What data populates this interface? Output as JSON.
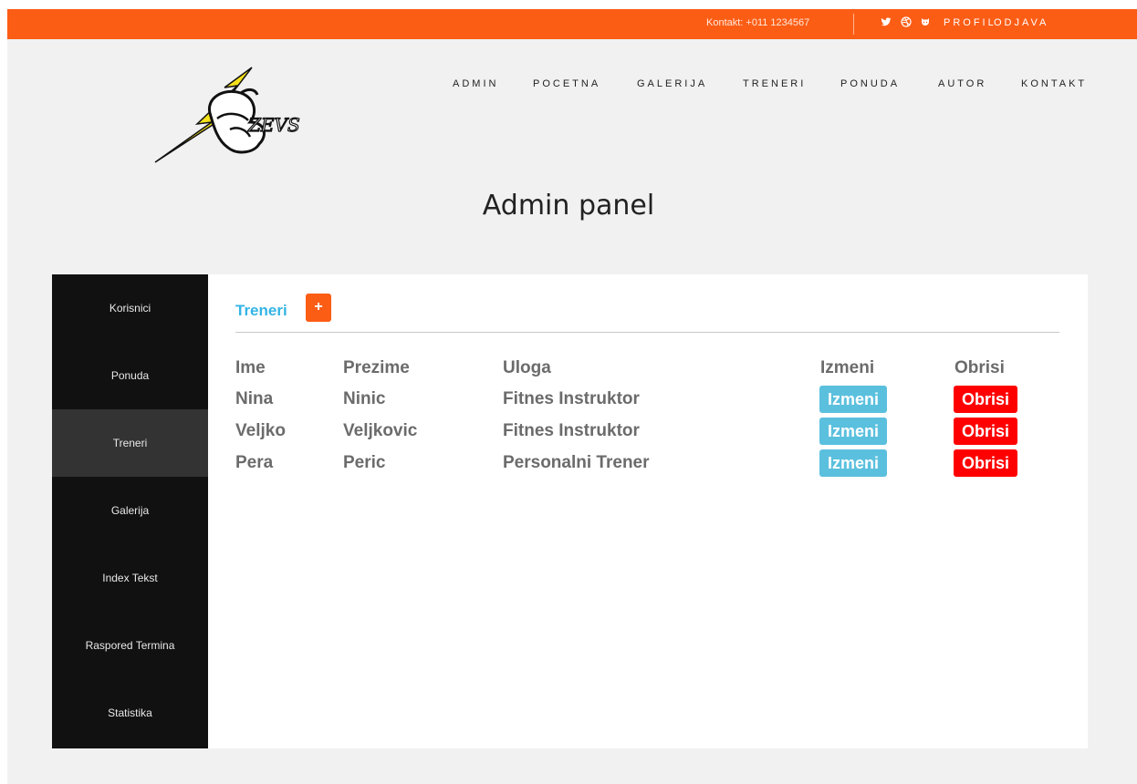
{
  "topbar": {
    "contact": "Kontakt: +011 1234567",
    "icons": [
      "twitter-icon",
      "dribbble-icon",
      "github-icon"
    ],
    "profile_label": "PROFIL",
    "logout_label": "ODJAVA",
    "accent": "#fc5d15"
  },
  "logo": {
    "text": "ZEVS"
  },
  "nav": {
    "items": [
      {
        "label": "ADMIN"
      },
      {
        "label": "POCETNA"
      },
      {
        "label": "GALERIJA"
      },
      {
        "label": "TRENERI"
      },
      {
        "label": "PONUDA"
      },
      {
        "label": "AUTOR"
      },
      {
        "label": "KONTAKT"
      }
    ]
  },
  "page": {
    "title": "Admin panel"
  },
  "sidebar": {
    "items": [
      {
        "label": "Korisnici"
      },
      {
        "label": "Ponuda"
      },
      {
        "label": "Treneri"
      },
      {
        "label": "Galerija"
      },
      {
        "label": "Index Tekst"
      },
      {
        "label": "Raspored Termina"
      },
      {
        "label": "Statistika"
      }
    ],
    "active": "Treneri"
  },
  "content": {
    "section_title": "Treneri",
    "add_label": "+",
    "headers": {
      "ime": "Ime",
      "prezime": "Prezime",
      "uloga": "Uloga",
      "izmeni": "Izmeni",
      "obrisi": "Obrisi"
    },
    "rows": [
      {
        "ime": "Nina",
        "prezime": "Ninic",
        "uloga": "Fitnes Instruktor",
        "edit": "Izmeni",
        "delete": "Obrisi"
      },
      {
        "ime": "Veljko",
        "prezime": "Veljkovic",
        "uloga": "Fitnes Instruktor",
        "edit": "Izmeni",
        "delete": "Obrisi"
      },
      {
        "ime": "Pera",
        "prezime": "Peric",
        "uloga": "Personalni Trener",
        "edit": "Izmeni",
        "delete": "Obrisi"
      }
    ],
    "colors": {
      "edit": "#5bc0de",
      "delete": "#ff0000",
      "title": "#33b5e5"
    }
  }
}
